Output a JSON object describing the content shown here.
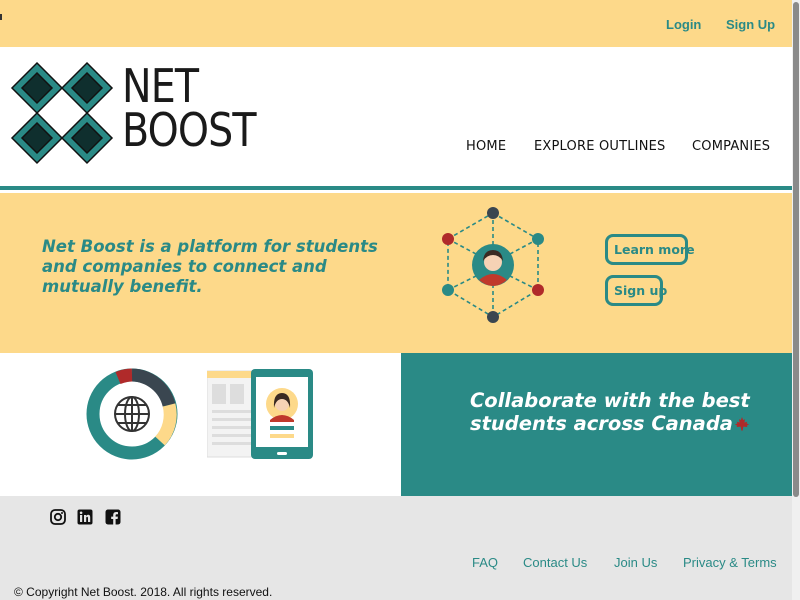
{
  "top_bar": {
    "login_label": "Login",
    "signup_label": "Sign Up"
  },
  "header": {
    "logo": {
      "line1": "NET",
      "line2": "BOOST"
    },
    "nav": {
      "home": "HOME",
      "explore": "EXPLORE OUTLINES",
      "companies": "COMPANIES"
    }
  },
  "hero": {
    "tagline": "Net Boost is a platform for students and companies to connect and mutually benefit.",
    "learn_more_label": "Learn more",
    "signup_label": "Sign up"
  },
  "collab_band": {
    "text": "Collaborate with the best students across Canada"
  },
  "footer": {
    "social_icons": [
      "instagram-icon",
      "linkedin-icon",
      "facebook-icon"
    ],
    "links": {
      "faq": "FAQ",
      "contact": "Contact Us",
      "join": "Join Us",
      "privacy": "Privacy & Terms"
    },
    "copyright": "© Copyright Net Boost. 2018. All rights reserved."
  },
  "colors": {
    "brand_teal": "#2a8a86",
    "brand_yellow": "#fdd98a",
    "footer_gray": "#e6e6e6",
    "accent_red": "#b02a2a",
    "dark_node": "#3a4650"
  }
}
